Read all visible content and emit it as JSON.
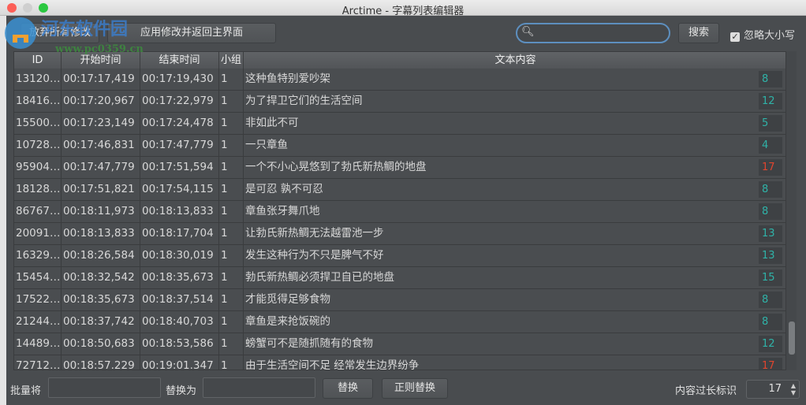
{
  "window": {
    "title": "Arctime - 字幕列表编辑器"
  },
  "watermark": {
    "text": "河东软件园",
    "url": "www.pc0359.cn"
  },
  "toolbar": {
    "discard_label": "放弃所有修改",
    "apply_label": "应用修改并返回主界面",
    "search_value": "",
    "search_label": "搜索",
    "ignore_case_label": "忽略大小写",
    "ignore_case_checked": true
  },
  "table": {
    "headers": [
      "ID",
      "开始时间",
      "结束时间",
      "小组",
      "文本内容"
    ],
    "rows": [
      [
        "13120…",
        "00:17:17,419",
        "00:17:19,430",
        "1",
        "这种鱼特别爱吵架",
        "8"
      ],
      [
        "18416…",
        "00:17:20,967",
        "00:17:22,979",
        "1",
        "为了捍卫它们的生活空间",
        "12"
      ],
      [
        "15500…",
        "00:17:23,149",
        "00:17:24,478",
        "1",
        "非如此不可",
        "5"
      ],
      [
        "10728…",
        "00:17:46,831",
        "00:17:47,779",
        "1",
        "一只章鱼",
        "4"
      ],
      [
        "95904…",
        "00:17:47,779",
        "00:17:51,594",
        "1",
        "一个不小心晃悠到了勃氏新热鲷的地盘",
        "17"
      ],
      [
        "18128…",
        "00:17:51,821",
        "00:17:54,115",
        "1",
        "是可忍 孰不可忍",
        "8"
      ],
      [
        "86767…",
        "00:18:11,973",
        "00:18:13,833",
        "1",
        "章鱼张牙舞爪地",
        "8"
      ],
      [
        "20091…",
        "00:18:13,833",
        "00:18:17,704",
        "1",
        "让勃氏新热鲷无法越雷池一步",
        "13"
      ],
      [
        "16329…",
        "00:18:26,584",
        "00:18:30,019",
        "1",
        "发生这种行为不只是脾气不好",
        "13"
      ],
      [
        "15454…",
        "00:18:32,542",
        "00:18:35,673",
        "1",
        "勃氏新热鲷必须捍卫自已的地盘",
        "15"
      ],
      [
        "17522…",
        "00:18:35,673",
        "00:18:37,514",
        "1",
        "才能觅得足够食物",
        "8"
      ],
      [
        "21244…",
        "00:18:37,742",
        "00:18:40,703",
        "1",
        "章鱼是来抢饭碗的",
        "8"
      ],
      [
        "14489…",
        "00:18:50,683",
        "00:18:53,586",
        "1",
        "螃蟹可不是随抓随有的食物",
        "12"
      ],
      [
        "72712…",
        "00:18:57.229",
        "00:19:01.347",
        "1",
        "由于生活空间不足 经常发生边界纷争",
        "17"
      ]
    ]
  },
  "bottom": {
    "batch_label": "批量将",
    "replace_with_label": "替换为",
    "find_value": "",
    "replace_value": "",
    "replace_button": "替换",
    "regex_button": "正则替换",
    "overlength_label": "内容过长标识",
    "overlength_value": "17"
  },
  "colors": {
    "ok": "#2fb3a8",
    "over": "#e0452e"
  }
}
